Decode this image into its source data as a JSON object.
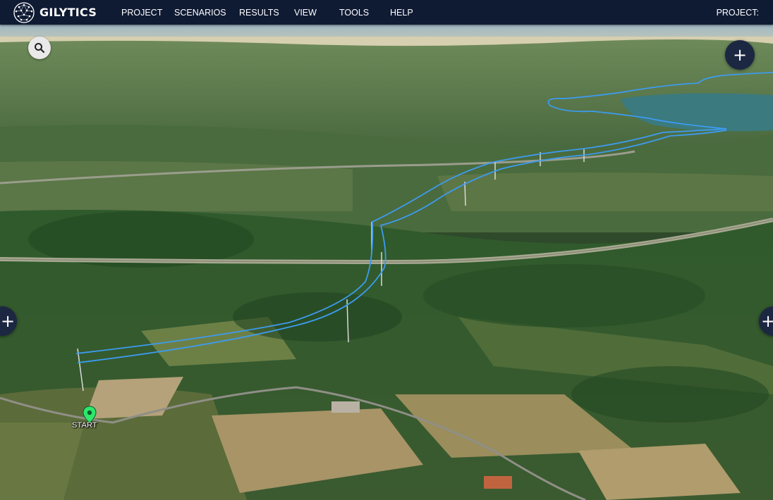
{
  "app": {
    "logo_text": "GILYTICS",
    "menu": [
      "PROJECT",
      "SCENARIOS",
      "RESULTS",
      "VIEW",
      "TOOLS",
      "HELP"
    ],
    "project_label": "PROJECT:"
  },
  "map": {
    "start_label": "START",
    "route_color": "#3d9bf0",
    "marker_color": "#2ee86b",
    "plus_symbol": "+"
  },
  "icons": {
    "search": "search-icon",
    "zoom_in": "plus-icon",
    "start": "map-pin-icon"
  }
}
